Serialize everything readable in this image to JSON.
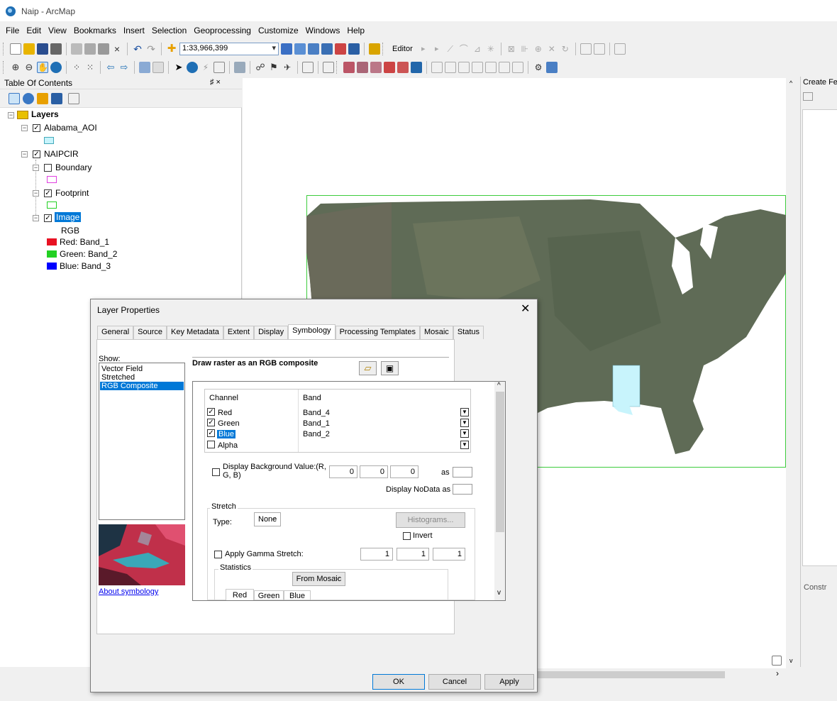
{
  "window": {
    "title": "Naip - ArcMap"
  },
  "menubar": [
    "File",
    "Edit",
    "View",
    "Bookmarks",
    "Insert",
    "Selection",
    "Geoprocessing",
    "Customize",
    "Windows",
    "Help"
  ],
  "toolbar": {
    "scale": "1:33,966,399",
    "editor": "Editor"
  },
  "toc": {
    "title": "Table Of Contents",
    "pin": "♯ ×",
    "root": "Layers",
    "layer1": "Alabama_AOI",
    "layer2": "NAIPCIR",
    "sub1": "Boundary",
    "sub2": "Footprint",
    "sub3": "Image",
    "rgb": "RGB",
    "red": "Red:  Band_1",
    "green": "Green: Band_2",
    "blue": "Blue:  Band_3"
  },
  "rightpanel": {
    "title": "Create Fe",
    "construct": "Constr"
  },
  "dialog": {
    "title": "Layer Properties",
    "close": "✕",
    "tabs": [
      "General",
      "Source",
      "Key Metadata",
      "Extent",
      "Display",
      "Symbology",
      "Processing Templates",
      "Mosaic",
      "Status"
    ],
    "selected_tab": "Symbology",
    "show_label": "Show:",
    "show_items": [
      "Vector Field",
      "Stretched",
      "RGB Composite"
    ],
    "about": "About symbology",
    "draw_title": "Draw raster as an RGB composite",
    "grid": {
      "col1": "Channel",
      "col2": "Band",
      "rows": [
        {
          "ch": "Red",
          "band": "Band_4",
          "checked": true
        },
        {
          "ch": "Green",
          "band": "Band_1",
          "checked": true
        },
        {
          "ch": "Blue",
          "band": "Band_2",
          "checked": true
        },
        {
          "ch": "Alpha",
          "band": "",
          "checked": false
        }
      ]
    },
    "bg_label_1": "Display Background Value:(R,",
    "bg_label_2": "G, B)",
    "bg_values": [
      "0",
      "0",
      "0"
    ],
    "as_label": "as",
    "nodata_label": "Display NoData as",
    "stretch": {
      "label": "Stretch",
      "type_label": "Type:",
      "type_value": "None",
      "histograms": "Histograms...",
      "invert": "Invert"
    },
    "gamma": {
      "label": "Apply Gamma Stretch:",
      "values": [
        "1",
        "1",
        "1"
      ]
    },
    "statistics": {
      "label": "Statistics",
      "source": "From Mosaic",
      "tabs": [
        "Red",
        "Green",
        "Blue"
      ]
    },
    "buttons": {
      "ok": "OK",
      "cancel": "Cancel",
      "apply": "Apply"
    }
  },
  "colors": {
    "red": "#e81123",
    "green": "#22d022",
    "blue": "#0000ff",
    "select": "#0078d7",
    "aoi": "#c8f4fc"
  }
}
